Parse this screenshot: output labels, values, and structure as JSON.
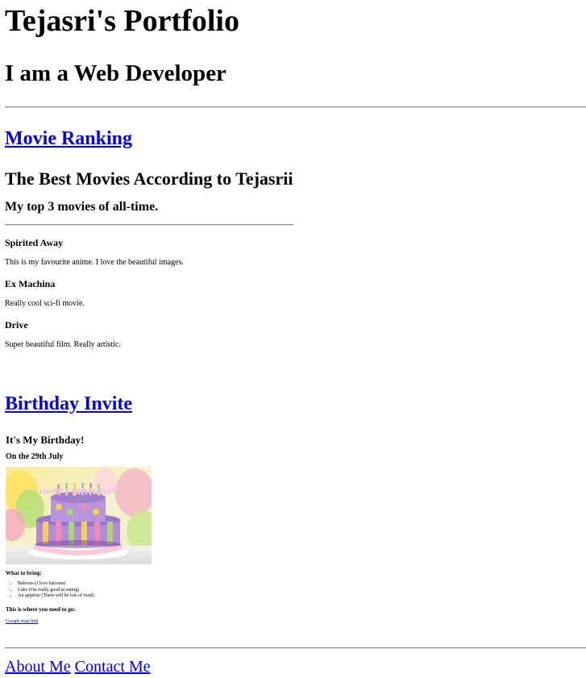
{
  "header": {
    "title": "Tejasri's Portfolio",
    "subtitle": "I am a Web Developer"
  },
  "movie_section": {
    "link_text": "Movie Ranking",
    "heading": "The Best Movies According to Tejasrii",
    "subheading": "My top 3 movies of all-time.",
    "movies": [
      {
        "title": "Spirited Away",
        "description": "This is my favourite anime. I love the beautiful images."
      },
      {
        "title": "Ex Machina",
        "description": "Really cool sci-fi movie."
      },
      {
        "title": "Drive",
        "description": "Super beautiful film. Really artistic."
      }
    ]
  },
  "birthday_section": {
    "link_text": "Birthday Invite",
    "heading": "It's My Birthday!",
    "date": "On the 29th July",
    "cake_banner": "HAPPY BIRTHDAY",
    "bring_heading": "What to bring:",
    "bring_items": [
      "Baloons (I love baloons)",
      "Cake (I'm really good at eating)",
      "An appetite (There will be lots of food)"
    ],
    "directions_heading": "This is where you need to go:",
    "map_link_text": "Google map link"
  },
  "footer_nav": {
    "about": "About Me",
    "contact": "Contact Me"
  },
  "colors": {
    "link": "#0000ee",
    "text": "#000000",
    "rule": "#8a8a8a"
  }
}
